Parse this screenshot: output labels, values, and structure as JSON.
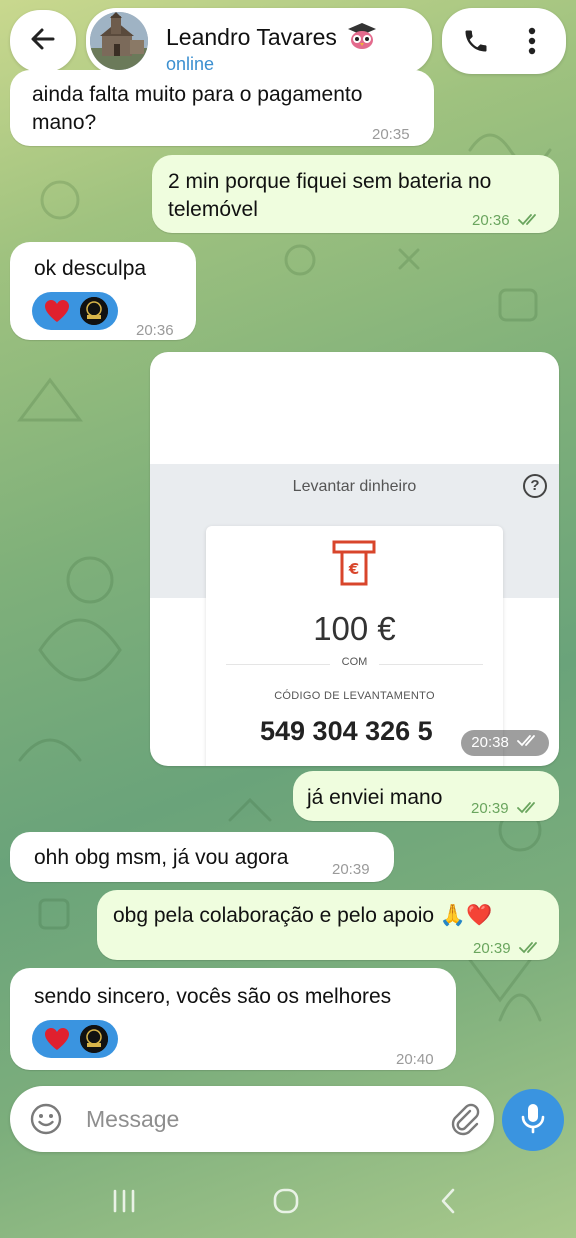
{
  "header": {
    "contact_name": "Leandro Tavares",
    "contact_emoji": "graduation-owl-emoji",
    "status": "online"
  },
  "messages": [
    {
      "dir": "in",
      "text_lines": [
        "ainda falta muito para o pagamento",
        "mano?"
      ],
      "time": "20:35"
    },
    {
      "dir": "out",
      "text_lines": [
        "2 min porque fiquei sem bateria no",
        "telemóvel"
      ],
      "time": "20:36",
      "read": true
    },
    {
      "dir": "in",
      "text_lines": [
        "ok desculpa"
      ],
      "time": "20:36",
      "reaction": "❤️"
    },
    {
      "dir": "out",
      "type": "image",
      "time": "20:38",
      "read": true,
      "image": {
        "title": "Levantar dinheiro",
        "help_symbol": "?",
        "amount": "100 €",
        "method": "COM",
        "code_label": "CÓDIGO DE LEVANTAMENTO",
        "code": "549 304 326 5"
      }
    },
    {
      "dir": "out",
      "text_lines": [
        "já enviei mano"
      ],
      "time": "20:39",
      "read": true
    },
    {
      "dir": "in",
      "text_lines": [
        "ohh obg msm, já vou agora"
      ],
      "time": "20:39"
    },
    {
      "dir": "out",
      "text_lines": [
        "obg pela colaboração e pelo apoio 🙏❤️"
      ],
      "time": "20:39",
      "read": true
    },
    {
      "dir": "in",
      "text_lines": [
        "sendo sincero, vocês são os melhores"
      ],
      "time": "20:40",
      "reaction": "❤️"
    }
  ],
  "composer": {
    "placeholder": "Message"
  },
  "colors": {
    "accent": "#3a94e0",
    "outgoing_bubble": "#effdde",
    "incoming_bubble": "#ffffff",
    "read_ticks": "#6aa55e"
  }
}
